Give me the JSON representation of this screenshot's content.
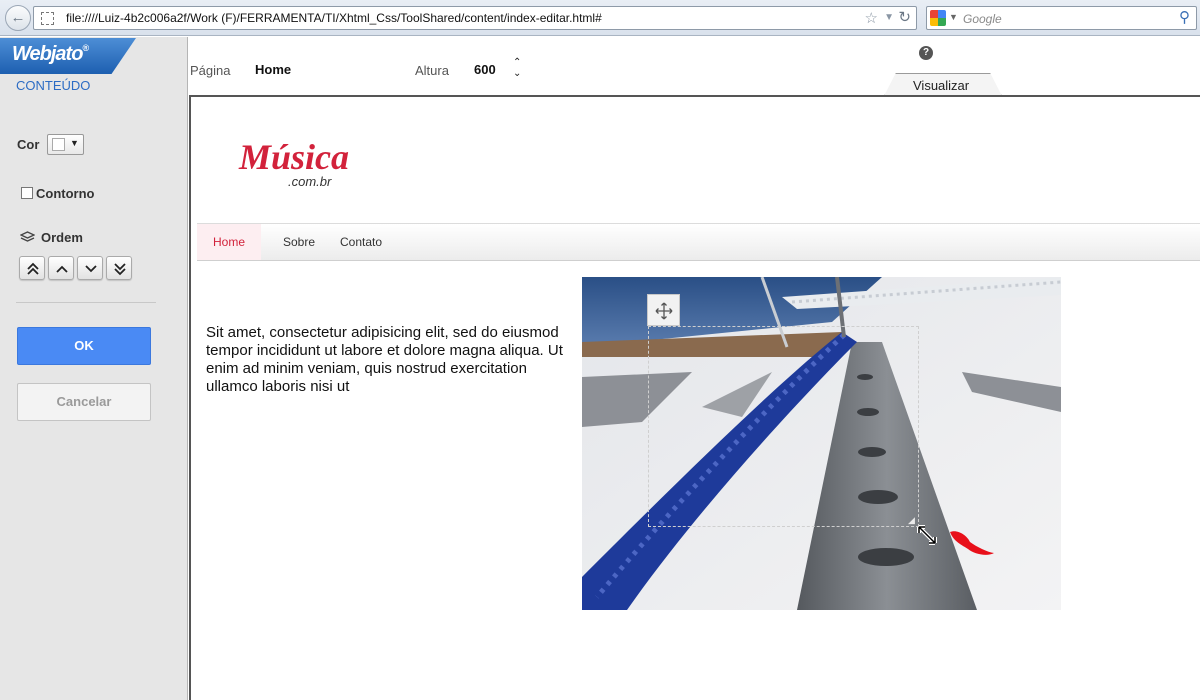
{
  "browser": {
    "url": "file:////Luiz-4b2c006a2f/Work  (F)/FERRAMENTA/TI/Xhtml_Css/ToolShared/content/index-editar.html#",
    "search_placeholder": "Google",
    "icons": [
      "back-arrow-icon",
      "site-identity-icon",
      "bookmark-star-icon",
      "url-dropdown-icon",
      "reload-icon",
      "google-search-icon",
      "search-magnifier-icon"
    ]
  },
  "sidebar": {
    "logo": {
      "name": "Web",
      "suffix": "jato",
      "mark": "®"
    },
    "section_title": "CONTEÚDO",
    "color_label": "Cor",
    "color_value": "#ffffff",
    "outline_label": "Contorno",
    "outline_checked": false,
    "order_label": "Ordem",
    "order_buttons": [
      "bring-to-front",
      "bring-forward",
      "send-backward",
      "send-to-back"
    ],
    "ok_label": "OK",
    "cancel_label": "Cancelar"
  },
  "toolbar": {
    "page_label": "Página",
    "page_value": "Home",
    "height_label": "Altura",
    "height_value": "600",
    "help_symbol": "?",
    "preview_tab": "Visualizar"
  },
  "site": {
    "logo_text": "Música",
    "logo_domain": ".com.br",
    "nav": [
      "Home",
      "Sobre",
      "Contato"
    ],
    "active_nav": "Home",
    "body_text": "Sit amet, consectetur adipisicing elit, sed do eiusmod tempor incididunt ut  labore et dolore magna aliqua. Ut enim ad minim veniam, quis nostrud exercitation ullamco laboris nisi ut"
  },
  "colors": {
    "brand_blue": "#2c6cc4",
    "ok_button": "#4a8af4",
    "site_accent_red": "#d2223b",
    "nav_active_bg": "#fdeef1"
  }
}
